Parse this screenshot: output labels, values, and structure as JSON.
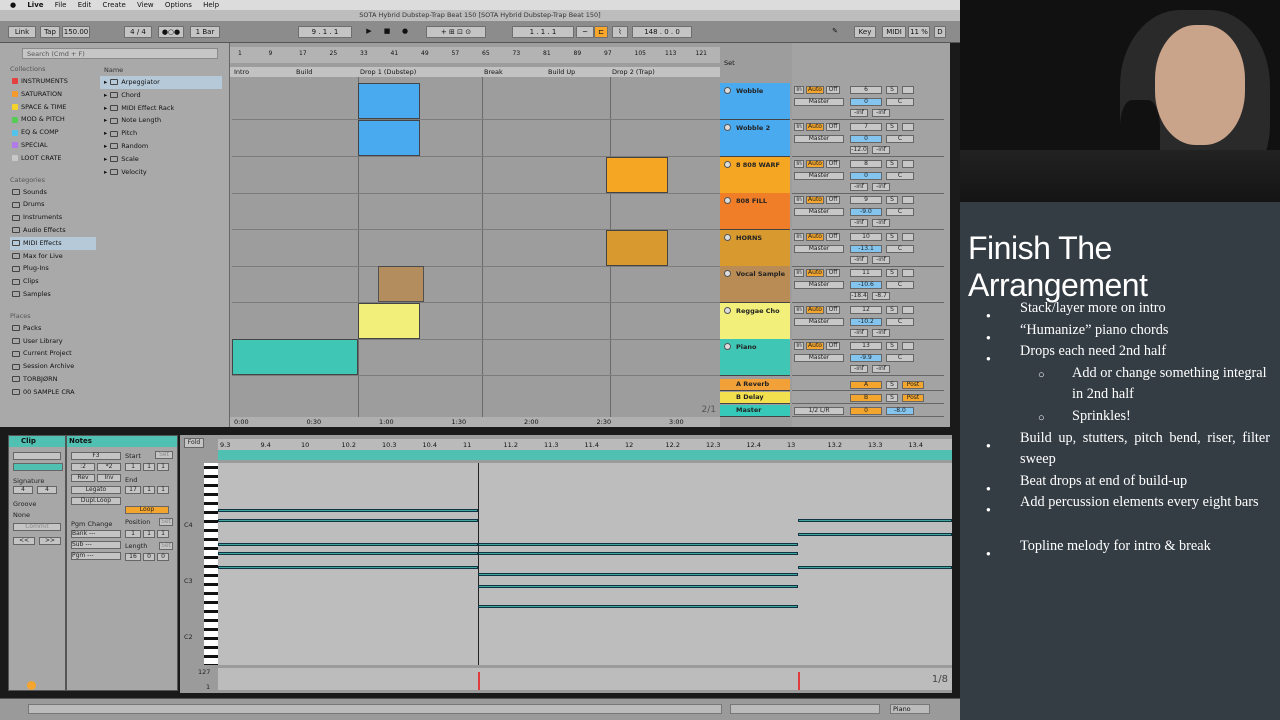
{
  "menubar": {
    "apple": "",
    "items": [
      "Live",
      "File",
      "Edit",
      "Create",
      "View",
      "Options",
      "Help"
    ]
  },
  "window_title": "SOTA Hybrid Dubstep-Trap Beat 150  [SOTA Hybrid Dubstep-Trap Beat 150]",
  "control_bar": {
    "link": "Link",
    "tap": "Tap",
    "tempo": "150.00",
    "signature": "4 / 4",
    "quantize": "1 Bar",
    "position": "9 .  1 .  1",
    "loop_start": "1 .  1 .  1",
    "loop_length": "148 .  0 .  0",
    "key": "Key",
    "midi": "MIDI",
    "cpu": "11 %",
    "d": "D"
  },
  "browser": {
    "search_placeholder": "Search (Cmd + F)",
    "collections_header": "Collections",
    "collections": [
      {
        "label": "INSTRUMENTS",
        "color": "#e64040"
      },
      {
        "label": "SATURATION",
        "color": "#f59a2b"
      },
      {
        "label": "SPACE & TIME",
        "color": "#f5d32b"
      },
      {
        "label": "MOD & PITCH",
        "color": "#55cc55"
      },
      {
        "label": "EQ & COMP",
        "color": "#52c3ea"
      },
      {
        "label": "SPECIAL",
        "color": "#b27ae8"
      },
      {
        "label": "LOOT CRATE",
        "color": "#c8c8c8"
      }
    ],
    "categories_header": "Categories",
    "categories": [
      "Sounds",
      "Drums",
      "Instruments",
      "Audio Effects",
      "MIDI Effects",
      "Max for Live",
      "Plug-Ins",
      "Clips",
      "Samples"
    ],
    "places_header": "Places",
    "places": [
      "Packs",
      "User Library",
      "Current Project",
      "Session Archive",
      "TORBJØRN",
      "00 SAMPLE CRA"
    ],
    "name_header": "Name",
    "items": [
      "Arpeggiator",
      "Chord",
      "MIDI Effect Rack",
      "Note Length",
      "Pitch",
      "Random",
      "Scale",
      "Velocity"
    ]
  },
  "arrangement": {
    "ruler": [
      "1",
      "9",
      "17",
      "25",
      "33",
      "41",
      "49",
      "57",
      "65",
      "73",
      "81",
      "89",
      "97",
      "105",
      "113",
      "121"
    ],
    "locators": [
      "Intro",
      "Build",
      "Drop 1 (Dubstep)",
      "Break",
      "Build Up",
      "Drop 2 (Trap)"
    ],
    "set_label": "Set",
    "time_labels": [
      "0:00",
      "0:30",
      "1:00",
      "1:30",
      "2:00",
      "2:30",
      "3:00"
    ],
    "zoom": "2/1"
  },
  "tracks": [
    {
      "name": "Wobble",
      "color": "#4aaaf0",
      "num": "6",
      "vol": "0",
      "pan": "C",
      "send1": "-inf",
      "send2": "-inf"
    },
    {
      "name": "Wobble 2",
      "color": "#4aaaf0",
      "num": "7",
      "vol": "0",
      "pan": "C",
      "send1": "-12.0",
      "send2": "-inf"
    },
    {
      "name": "8 808 WARF",
      "color": "#f5a623",
      "num": "8",
      "vol": "0",
      "pan": "C",
      "send1": "-inf",
      "send2": "-inf"
    },
    {
      "name": "808 FILL",
      "color": "#f07d28",
      "num": "9",
      "vol": "-9.0",
      "pan": "C",
      "send1": "-inf",
      "send2": "-inf"
    },
    {
      "name": "HORNS",
      "color": "#d89a2e",
      "num": "10",
      "vol": "-13.1",
      "pan": "C",
      "send1": "-inf",
      "send2": "-inf"
    },
    {
      "name": "Vocal Sample",
      "color": "#b98b55",
      "num": "11",
      "vol": "-10.6",
      "pan": "C",
      "send1": "-18.4",
      "send2": "-8.7"
    },
    {
      "name": "Reggae Cho",
      "color": "#f2f07a",
      "num": "12",
      "vol": "-10.2",
      "pan": "C",
      "send1": "-inf",
      "send2": "-inf"
    },
    {
      "name": "Piano",
      "color": "#3fc6b5",
      "num": "13",
      "vol": "-9.9",
      "pan": "C",
      "send1": "-inf",
      "send2": "-inf"
    }
  ],
  "returns": [
    {
      "name": "A Reverb",
      "color": "#f2a038",
      "letter": "A",
      "post": "Post"
    },
    {
      "name": "B Delay",
      "color": "#f3e04e",
      "letter": "B",
      "post": "Post"
    },
    {
      "name": "Master",
      "color": "#36c9b9",
      "routing": "1/2 L/R",
      "vol": "0",
      "vol2": "-8.0"
    }
  ],
  "mixer_labels": {
    "in": "In",
    "auto": "Auto",
    "off": "Off",
    "master": "Master",
    "s": "S"
  },
  "clip_view": {
    "clip_header": "Clip",
    "notes_header": "Notes",
    "signature_label": "Signature",
    "sig_num": "4",
    "sig_den": "4",
    "groove_label": "Groove",
    "groove_value": "None",
    "commit": "Commit",
    "note_value": "F3",
    "half": ":2",
    "double": "*2",
    "rev": "Rev",
    "inv": "Inv",
    "legato": "Legato",
    "dupl_loop": "Dupl.Loop",
    "start_label": "Start",
    "set": "Set",
    "start_val": [
      "1",
      "1",
      "1"
    ],
    "end_label": "End",
    "end_val": [
      "17",
      "1",
      "1"
    ],
    "loop": "Loop",
    "position_label": "Position",
    "position_val": [
      "1",
      "1",
      "1"
    ],
    "length_label": "Length",
    "length_val": [
      "16",
      "0",
      "0"
    ],
    "pgm_change": "Pgm Change",
    "bank": "Bank ---",
    "sub": "Sub ---",
    "pgm": "Pgm ---",
    "fold": "Fold",
    "piano_ruler": [
      "9.3",
      "9.4",
      "10",
      "10.2",
      "10.3",
      "10.4",
      "11",
      "11.2",
      "11.3",
      "11.4",
      "12",
      "12.2",
      "12.3",
      "12.4",
      "13",
      "13.2",
      "13.3",
      "13.4"
    ],
    "key_labels": [
      "C4",
      "C3",
      "C2"
    ],
    "vel_top": "127",
    "vel_bottom": "1",
    "page": "1/8"
  },
  "status_bar": {
    "track": "Piano"
  },
  "slide": {
    "title": "Finish The Arrangement",
    "bullets": [
      {
        "text": "Stack/layer more on intro",
        "level": 1
      },
      {
        "text": "“Humanize” piano chords",
        "level": 1
      },
      {
        "text": "Drops each need 2nd half",
        "level": 1
      },
      {
        "text": "Add or change something integral in 2nd half",
        "level": 2
      },
      {
        "text": "Sprinkles!",
        "level": 2
      },
      {
        "text": "Build up, stutters, pitch bend, riser, filter sweep",
        "level": 1
      },
      {
        "text": "Beat drops at end of build-up",
        "level": 1
      },
      {
        "text": "Add percussion elements every eight bars",
        "level": 1
      },
      {
        "text": "Topline melody for intro & break",
        "level": 1
      }
    ]
  }
}
